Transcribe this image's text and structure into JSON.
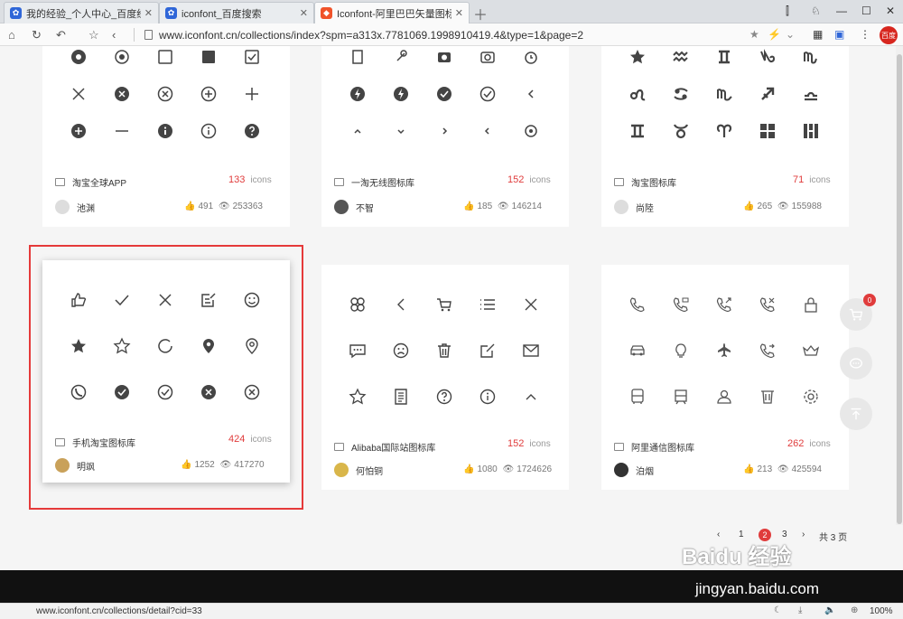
{
  "tabs": [
    {
      "title": "我的经验_个人中心_百度经验",
      "active": false
    },
    {
      "title": "iconfont_百度搜索",
      "active": false
    },
    {
      "title": "Iconfont-阿里巴巴矢量图标库",
      "active": true
    }
  ],
  "address": {
    "url": "www.iconfont.cn/collections/index?spm=a313x.7781069.1998910419.4&type=1&page=2"
  },
  "ext_avatar_text": "百度",
  "cards": [
    {
      "name": "淘宝全球APP",
      "count": "133",
      "unit": "icons",
      "user": "池渊",
      "likes": "491",
      "views": "253363"
    },
    {
      "name": "一淘无线图标库",
      "count": "152",
      "unit": "icons",
      "user": "不智",
      "likes": "185",
      "views": "146214"
    },
    {
      "name": "淘宝图标库",
      "count": "71",
      "unit": "icons",
      "user": "尚陸",
      "likes": "265",
      "views": "155988"
    },
    {
      "name": "手机淘宝图标库",
      "count": "424",
      "unit": "icons",
      "user": "明飒",
      "likes": "1252",
      "views": "417270"
    },
    {
      "name": "Alibaba国际站图标库",
      "count": "152",
      "unit": "icons",
      "user": "何怕铜",
      "likes": "1080",
      "views": "1724626"
    },
    {
      "name": "阿里通信图标库",
      "count": "262",
      "unit": "icons",
      "user": "泊烟",
      "likes": "213",
      "views": "425594"
    }
  ],
  "pager": {
    "prev": "‹",
    "pages": [
      "1",
      "2",
      "3"
    ],
    "current": "2",
    "next": "›",
    "total": "共 3 页"
  },
  "cart_badge": "0",
  "status": {
    "url": "www.iconfont.cn/collections/detail?cid=33",
    "zoom": "100%"
  },
  "watermark": {
    "brand": "Baidu 经验",
    "site": "jingyan.baidu.com"
  },
  "colors": {
    "accent": "#e03c3c",
    "highlight_border": "#e53a3a"
  }
}
